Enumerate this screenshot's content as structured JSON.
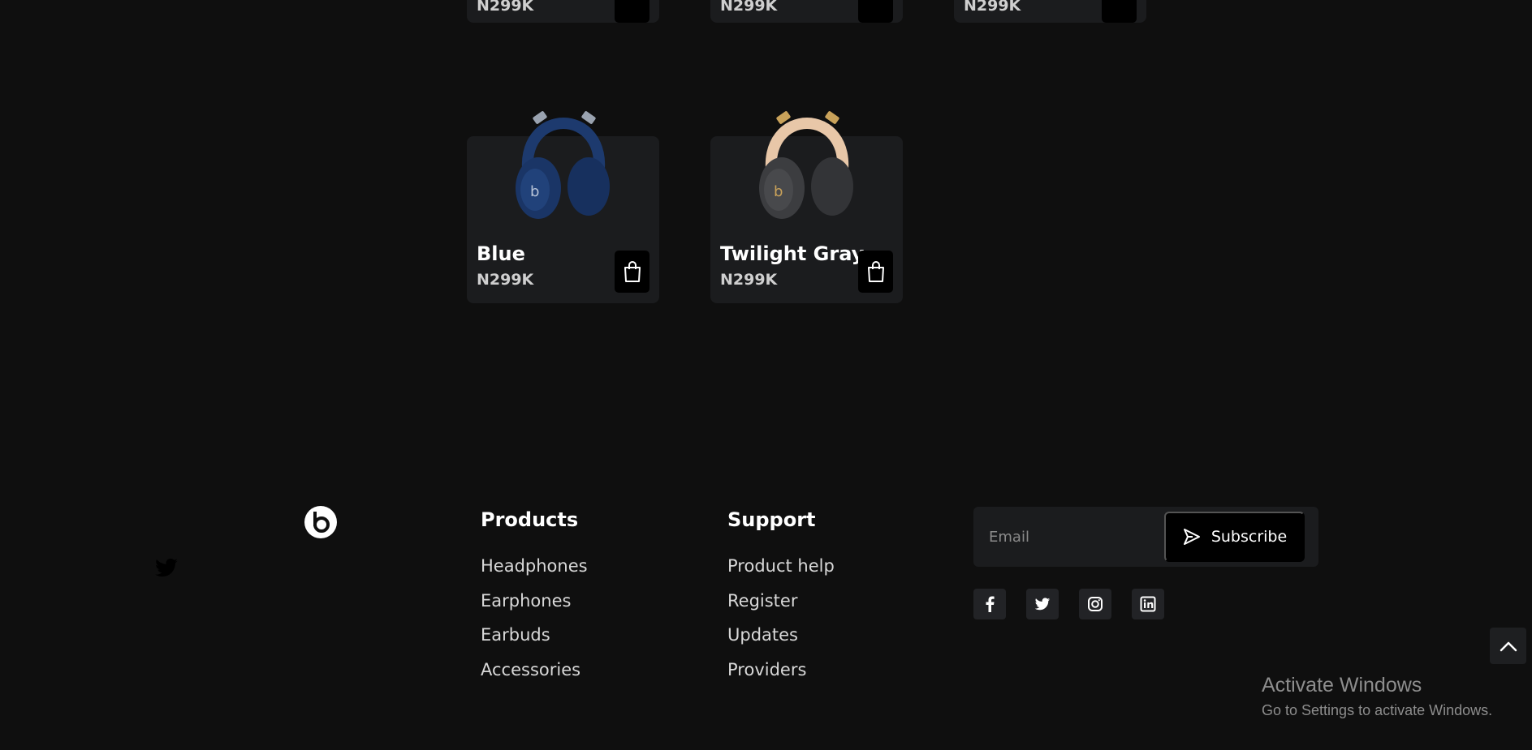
{
  "top_row": [
    {
      "price": "N299K"
    },
    {
      "price": "N299K"
    },
    {
      "price": "N299K"
    }
  ],
  "products": [
    {
      "name": "Blue",
      "price": "N299K",
      "color": "#1d3a6e"
    },
    {
      "name": "Twilight Gray",
      "price": "N299K",
      "color": "#3c3d40"
    }
  ],
  "footer": {
    "products_title": "Products",
    "products_links": [
      "Headphones",
      "Earphones",
      "Earbuds",
      "Accessories"
    ],
    "support_title": "Support",
    "support_links": [
      "Product help",
      "Register",
      "Updates",
      "Providers"
    ],
    "email_placeholder": "Email",
    "subscribe_label": "Subscribe",
    "social_icons": [
      "facebook-icon",
      "twitter-icon",
      "instagram-icon",
      "linkedin-icon"
    ]
  },
  "windows_notice": {
    "title": "Activate Windows",
    "subtitle": "Go to Settings to activate Windows."
  },
  "colors": {
    "background": "#0f0f0f",
    "card": "#1b1c1e",
    "button": "#000000"
  }
}
